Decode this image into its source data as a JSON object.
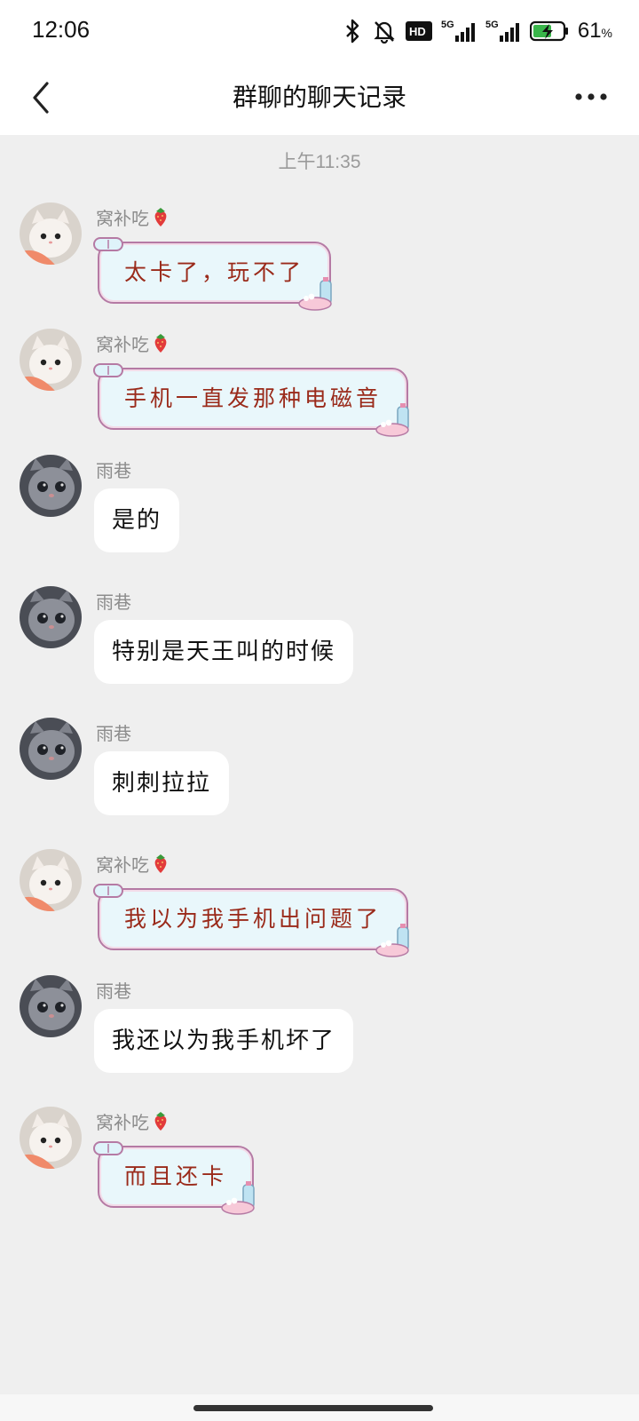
{
  "status_bar": {
    "time": "12:06",
    "battery_percent": "61",
    "battery_unit": "%",
    "icons": [
      "bluetooth-icon",
      "mute-bell-icon",
      "hd-icon",
      "signal-5g-icon",
      "signal-5g-icon",
      "battery-charging-icon"
    ]
  },
  "header": {
    "title": "群聊的聊天记录",
    "back_icon": "chevron-left-icon",
    "more_icon": "more-dots-icon"
  },
  "chat": {
    "timestamp": "上午11:35",
    "messages": [
      {
        "sender": "窝补吃",
        "text": "太卡了，玩不了",
        "style": "decorated",
        "avatar": "white-cat"
      },
      {
        "sender": "窝补吃",
        "text": "手机一直发那种电磁音",
        "style": "decorated",
        "avatar": "white-cat"
      },
      {
        "sender": "雨巷",
        "text": "是的",
        "style": "plain",
        "avatar": "gray-cat"
      },
      {
        "sender": "雨巷",
        "text": "特别是天王叫的时候",
        "style": "plain",
        "avatar": "gray-cat"
      },
      {
        "sender": "雨巷",
        "text": "刺刺拉拉",
        "style": "plain",
        "avatar": "gray-cat"
      },
      {
        "sender": "窝补吃",
        "text": "我以为我手机出问题了",
        "style": "decorated",
        "avatar": "white-cat"
      },
      {
        "sender": "雨巷",
        "text": "我还以为我手机坏了",
        "style": "plain",
        "avatar": "gray-cat"
      },
      {
        "sender": "窝补吃",
        "text": "而且还卡",
        "style": "decorated",
        "avatar": "white-cat"
      }
    ]
  },
  "colors": {
    "background": "#efefef",
    "header": "#ffffff",
    "deco_bubble_fill": "#e9f7fb",
    "deco_bubble_border": "#b57aa4",
    "deco_text": "#9a2a1a"
  }
}
